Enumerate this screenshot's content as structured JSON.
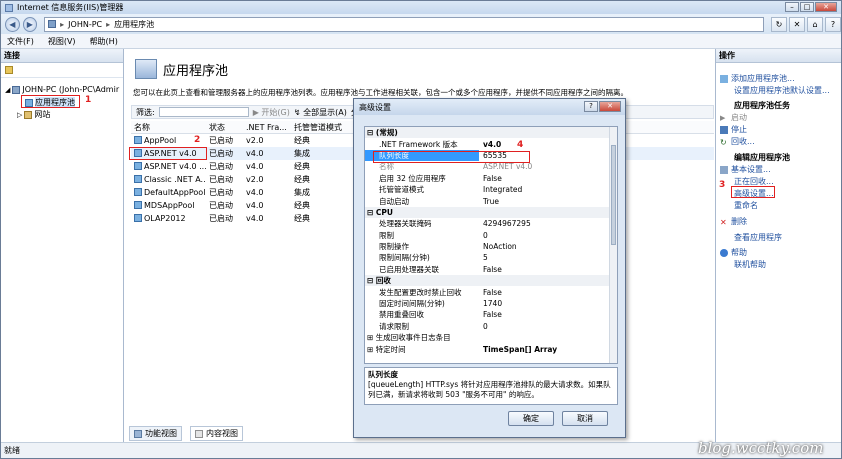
{
  "window": {
    "title": "Internet 信息服务(IIS)管理器"
  },
  "nav": {
    "crumbs": [
      "JOHN-PC",
      "应用程序池"
    ],
    "sep": "▸"
  },
  "menu": [
    "文件(F)",
    "视图(V)",
    "帮助(H)"
  ],
  "left": {
    "header": "连接",
    "tree": [
      "JOHN-PC (John-PC\\Admir",
      "应用程序池",
      "网站"
    ]
  },
  "center": {
    "title": "应用程序池",
    "description": "您可以在此页上查看和管理服务器上的应用程序池列表。应用程序池与工作进程相关联，包含一个或多个应用程序，并提供不同应用程序之间的隔离。",
    "filter": {
      "label": "筛选:",
      "go": "开始(G)",
      "show_all": "全部显示(A)",
      "group": "分"
    },
    "columns": [
      "名称",
      "状态",
      ".NET Fra...",
      "托管管道模式"
    ],
    "rows": [
      [
        "AppPool",
        "已启动",
        "v2.0",
        "经典"
      ],
      [
        "ASP.NET v4.0",
        "已启动",
        "v4.0",
        "集成"
      ],
      [
        "ASP.NET v4.0 ...",
        "已启动",
        "v4.0",
        "经典"
      ],
      [
        "Classic .NET A...",
        "已启动",
        "v2.0",
        "经典"
      ],
      [
        "DefaultAppPool",
        "已启动",
        "v4.0",
        "集成"
      ],
      [
        "MDSAppPool",
        "已启动",
        "v4.0",
        "经典"
      ],
      [
        "OLAP2012",
        "已启动",
        "v4.0",
        "经典"
      ]
    ],
    "tabs": [
      "功能视图",
      "内容视图"
    ]
  },
  "annotations": [
    "1",
    "2",
    "3",
    "4"
  ],
  "right": {
    "header": "操作",
    "actions": {
      "add": "添加应用程序池...",
      "defaults": "设置应用程序池默认设置...",
      "tasks_title": "应用程序池任务",
      "start": "启动",
      "stop": "停止",
      "recycle": "回收...",
      "edit_title": "编辑应用程序池",
      "basic": "基本设置...",
      "recycling": "正在回收...",
      "advanced": "高级设置...",
      "rename": "重命名",
      "delete": "删除",
      "view_apps": "查看应用程序",
      "help": "帮助",
      "online_help": "联机帮助"
    }
  },
  "status": "就绪",
  "dialog": {
    "title": "高级设置",
    "props": [
      {
        "k": "(常规)",
        "cat": true
      },
      {
        "k": ".NET Framework 版本",
        "v": "v4.0",
        "bold": true
      },
      {
        "k": "队列长度",
        "v": "65535",
        "sel": true
      },
      {
        "k": "名称",
        "v": "ASP.NET v4.0",
        "gray": true
      },
      {
        "k": "启用 32 位应用程序",
        "v": "False"
      },
      {
        "k": "托管管道模式",
        "v": "Integrated"
      },
      {
        "k": "自动启动",
        "v": "True"
      },
      {
        "k": "CPU",
        "cat": true
      },
      {
        "k": "处理器关联掩码",
        "v": "4294967295"
      },
      {
        "k": "限制",
        "v": "0"
      },
      {
        "k": "限制操作",
        "v": "NoAction"
      },
      {
        "k": "限制间隔(分钟)",
        "v": "5"
      },
      {
        "k": "已启用处理器关联",
        "v": "False"
      },
      {
        "k": "回收",
        "cat": true
      },
      {
        "k": "发生配置更改时禁止回收",
        "v": "False"
      },
      {
        "k": "固定时间间隔(分钟)",
        "v": "1740"
      },
      {
        "k": "禁用重叠回收",
        "v": "False"
      },
      {
        "k": "请求限制",
        "v": "0"
      },
      {
        "k": "生成回收事件日志条目",
        "v": "",
        "expand": true
      },
      {
        "k": "特定时间",
        "v": "TimeSpan[] Array",
        "bold": true,
        "expand": true
      }
    ],
    "desc_title": "队列长度",
    "desc_text": "[queueLength] HTTP.sys 将针对应用程序池排队的最大请求数。如果队列已满，新请求将收到 503 \"服务不可用\" 的响应。",
    "ok": "确定",
    "cancel": "取消"
  },
  "watermark": "blog.wcctky.com"
}
